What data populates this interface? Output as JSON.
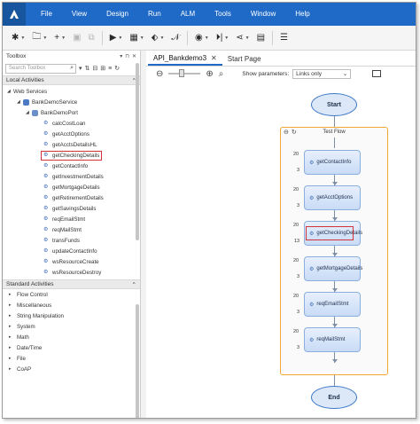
{
  "menu": [
    "File",
    "View",
    "Design",
    "Run",
    "ALM",
    "Tools",
    "Window",
    "Help"
  ],
  "toolbox": {
    "title": "Toolbox",
    "search_placeholder": "Search Toolbox",
    "local_activities": {
      "label": "Local Activities",
      "web_services": "Web Services",
      "service": "BankDemoService",
      "port": "BankDemoPort",
      "operations": [
        "calcCostLoan",
        "getAcctOptions",
        "getAcctsDetailsHL",
        "getCheckingDetails",
        "getContactInfo",
        "getInvestmentDetails",
        "getMortgageDetails",
        "getRetirementDetails",
        "getSavingsDetails",
        "reqEmailStmt",
        "reqMailStmt",
        "transFunds",
        "updateContactInfo",
        "wsResourceCreate",
        "wsResourceDestroy"
      ],
      "highlighted": "getCheckingDetails"
    },
    "standard_activities": {
      "label": "Standard Activities",
      "items": [
        "Flow Control",
        "Miscellaneous",
        "String Manipulation",
        "System",
        "Math",
        "Date/Time",
        "File",
        "CoAP"
      ]
    }
  },
  "tabs": [
    {
      "label": "API_Bankdemo3",
      "active": true
    },
    {
      "label": "Start Page",
      "active": false
    }
  ],
  "canvas_toolbar": {
    "show_params_label": "Show parameters:",
    "show_params_value": "Links only"
  },
  "flow": {
    "start": "Start",
    "end": "End",
    "test_flow_label": "Test Flow",
    "nodes": [
      {
        "label": "getContactInfo",
        "top_count": "20",
        "bottom_count": "3"
      },
      {
        "label": "getAcctOptions",
        "top_count": "20",
        "bottom_count": "3"
      },
      {
        "label": "getCheckingDetails",
        "top_count": "20",
        "bottom_count": "13"
      },
      {
        "label": "getMortgageDetails",
        "top_count": "20",
        "bottom_count": "3"
      },
      {
        "label": "reqEmailStmt",
        "top_count": "20",
        "bottom_count": "3"
      },
      {
        "label": "reqMailStmt",
        "top_count": "20",
        "bottom_count": "3"
      }
    ]
  },
  "colors": {
    "menubar": "#1f6ac7",
    "highlight": "#d3343a",
    "flow_frame": "#f0a830",
    "node_border": "#8aaee0"
  }
}
